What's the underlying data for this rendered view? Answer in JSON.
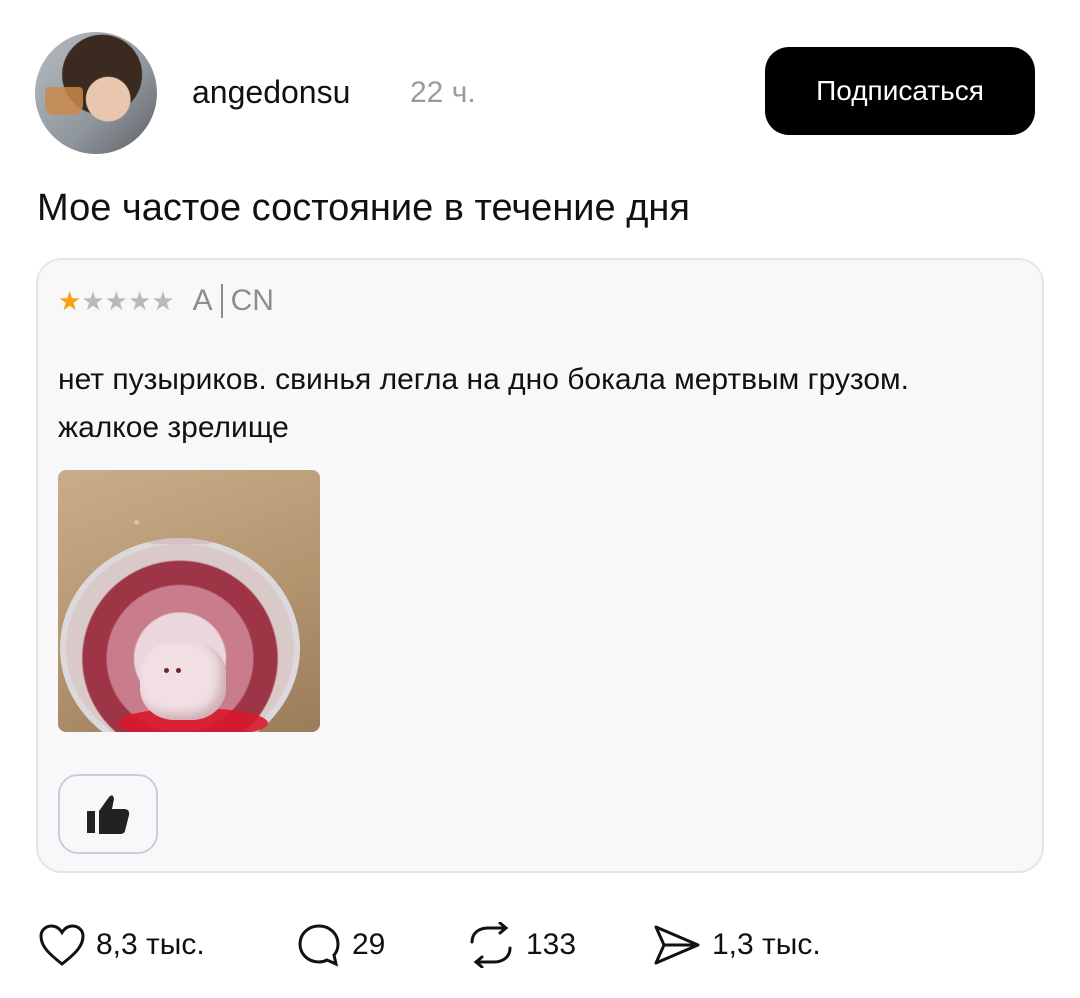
{
  "post": {
    "username": "angedonsu",
    "time": "22 ч.",
    "subscribe_label": "Подписаться",
    "caption": "Мое частое состояние в течение дня"
  },
  "review": {
    "rating": 1,
    "rating_max": 5,
    "lang_a": "A",
    "lang_b": "CN",
    "text": "нет пузыриков. свинья легла на дно бокала мертвым грузом. жалкое зрелище"
  },
  "actions": {
    "likes": "8,3 тыс.",
    "comments": "29",
    "reposts": "133",
    "shares": "1,3 тыс."
  },
  "colors": {
    "star_on": "#f4a20e",
    "star_off": "#b9b9b9",
    "button_bg": "#000000"
  },
  "icons": {
    "like": "heart-icon",
    "comment": "comment-bubble-icon",
    "repost": "repost-arrows-icon",
    "share": "send-arrow-icon",
    "thumb": "thumbs-up-icon"
  }
}
